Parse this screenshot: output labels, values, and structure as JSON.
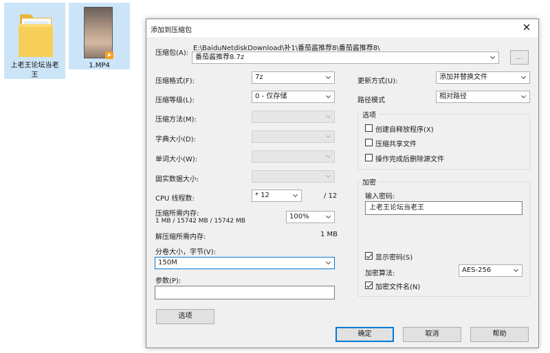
{
  "desktop": {
    "items": [
      {
        "label": "上老王论坛当老王",
        "type": "folder"
      },
      {
        "label": "1.MP4",
        "type": "video"
      }
    ]
  },
  "dialog": {
    "title": "添加到压缩包",
    "close_icon": "close-icon",
    "archive": {
      "label": "压缩包(A):",
      "path": "E:\\BaiduNetdiskDownload\\补1\\番茄酱推荐8\\番茄酱推荐8\\",
      "name": "番茄酱推荐8.7z",
      "browse_label": "..."
    },
    "left": {
      "format_label": "压缩格式(F):",
      "format_value": "7z",
      "level_label": "压缩等级(L):",
      "level_value": "0 - 仅存储",
      "method_label": "压缩方法(M):",
      "dict_label": "字典大小(D):",
      "word_label": "单词大小(W):",
      "solid_label": "固实数据大小:",
      "cpu_label": "CPU 线程数:",
      "cpu_value": "* 12",
      "cpu_total": "/ 12",
      "mem_comp_label": "压缩所需内存:",
      "mem_comp_value": "1 MB / 15742 MB / 15742 MB",
      "mem_percent": "100%",
      "mem_decomp_label": "解压缩所需内存:",
      "mem_decomp_value": "1 MB",
      "volume_label": "分卷大小，字节(V):",
      "volume_value": "150M",
      "params_label": "参数(P):",
      "params_value": "",
      "options_button": "选项"
    },
    "right": {
      "update_label": "更新方式(U):",
      "update_value": "添加并替换文件",
      "path_label": "路径模式",
      "path_value": "相对路径",
      "options_group": "选项",
      "opt_sfx": "创建自释放程序(X)",
      "opt_shared": "压缩共享文件",
      "opt_delete": "操作完成后删除源文件",
      "encrypt_group": "加密",
      "password_label": "输入密码:",
      "password_value": "上老王论坛当老王",
      "show_password": "显示密码(S)",
      "algo_label": "加密算法:",
      "algo_value": "AES-256",
      "encrypt_names": "加密文件名(N)"
    },
    "buttons": {
      "ok": "确定",
      "cancel": "取消",
      "help": "帮助"
    }
  }
}
